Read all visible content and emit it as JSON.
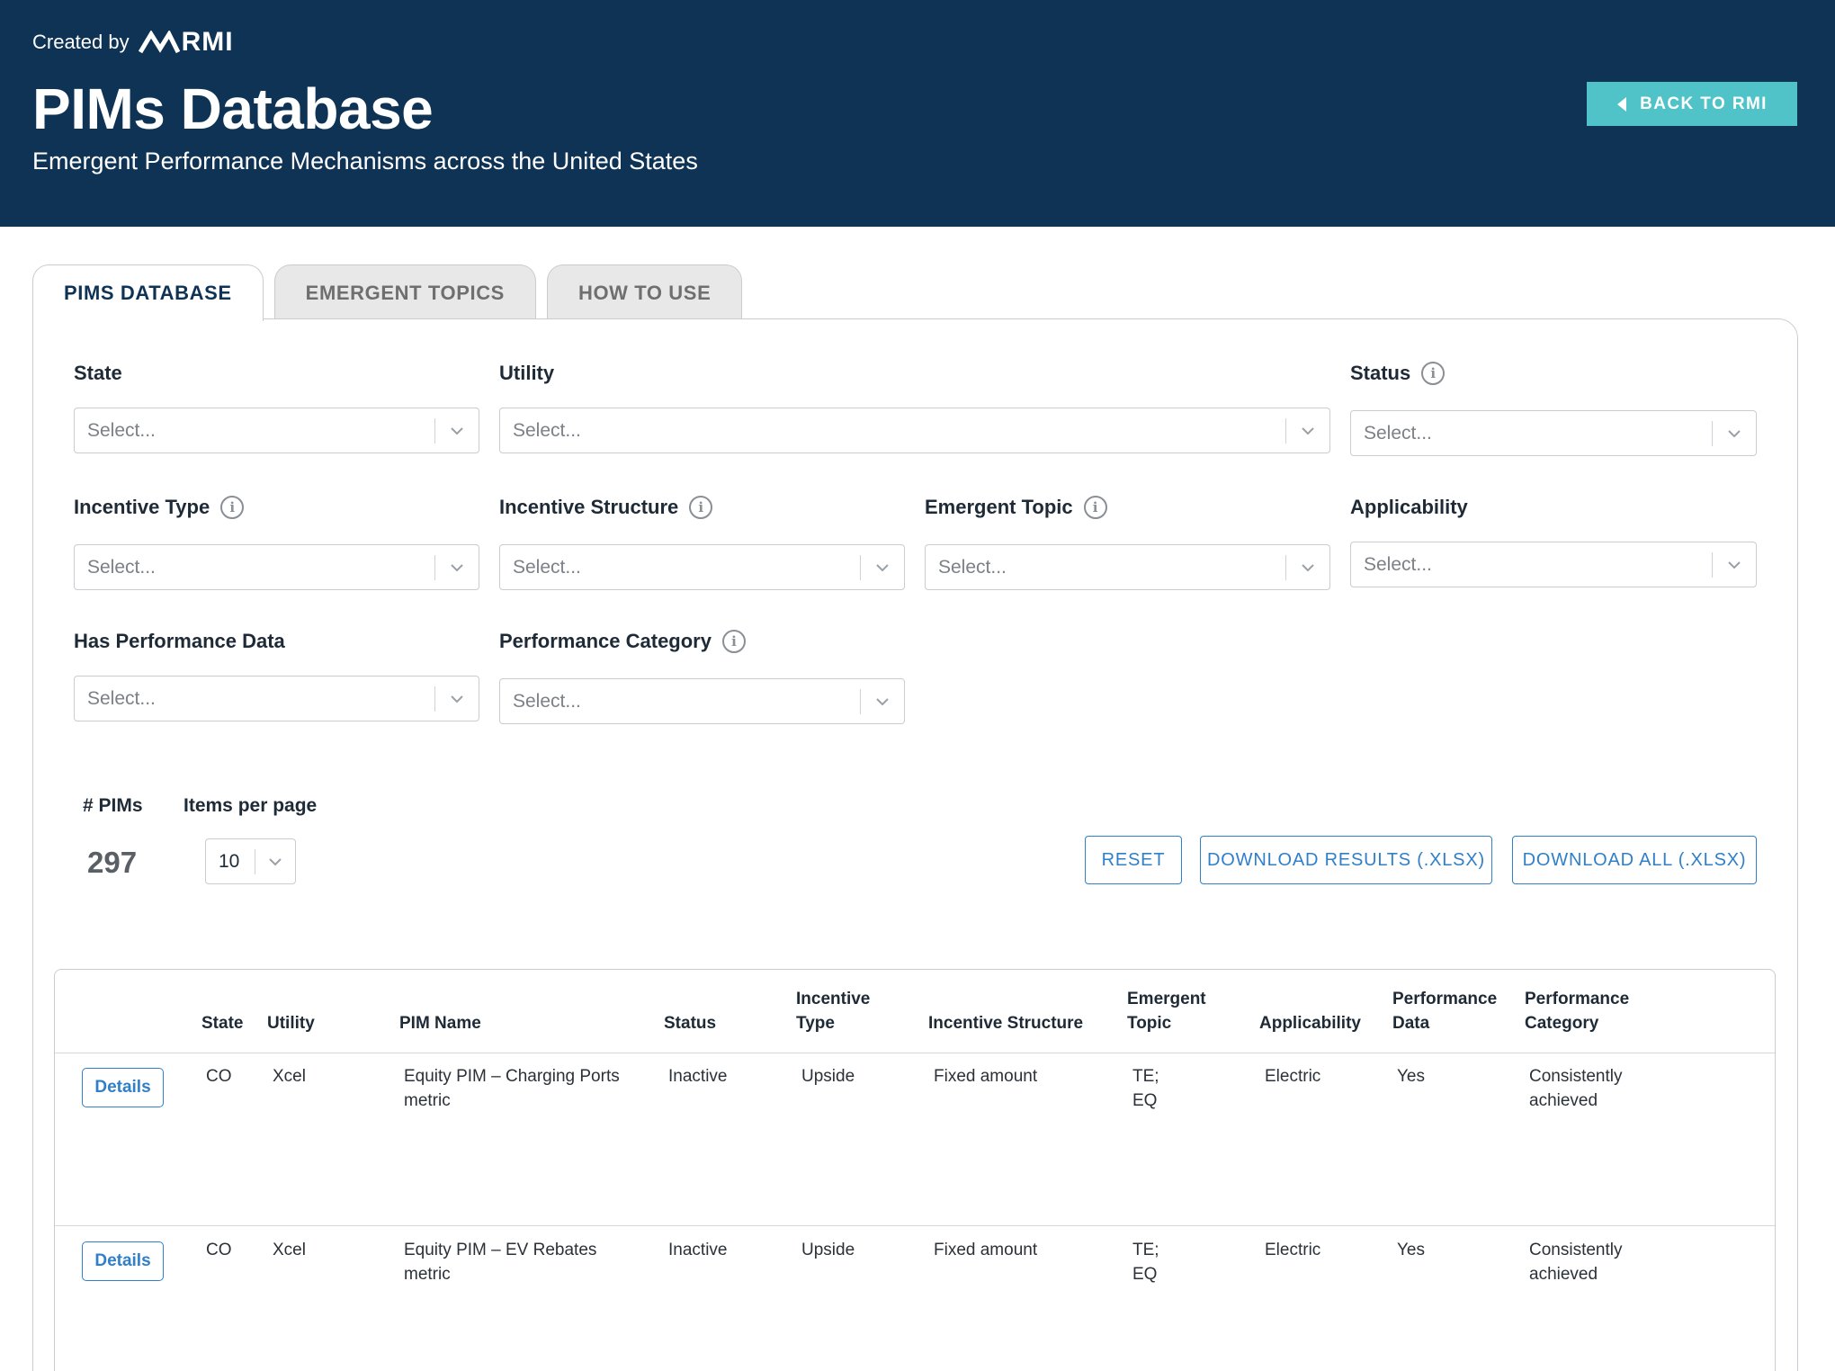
{
  "header": {
    "created_by": "Created by",
    "logo_text": "RMI",
    "title": "PIMs Database",
    "subtitle": "Emergent Performance Mechanisms across the United States",
    "back_button": "BACK TO RMI"
  },
  "tabs": [
    {
      "label": "PIMS DATABASE",
      "active": true
    },
    {
      "label": "EMERGENT TOPICS",
      "active": false
    },
    {
      "label": "HOW TO USE",
      "active": false
    }
  ],
  "filters": {
    "state": {
      "label": "State",
      "placeholder": "Select..."
    },
    "utility": {
      "label": "Utility",
      "placeholder": "Select..."
    },
    "status": {
      "label": "Status",
      "placeholder": "Select..."
    },
    "incentive_type": {
      "label": "Incentive Type",
      "placeholder": "Select..."
    },
    "incentive_structure": {
      "label": "Incentive Structure",
      "placeholder": "Select..."
    },
    "emergent_topic": {
      "label": "Emergent Topic",
      "placeholder": "Select..."
    },
    "applicability": {
      "label": "Applicability",
      "placeholder": "Select..."
    },
    "has_performance_data": {
      "label": "Has Performance Data",
      "placeholder": "Select..."
    },
    "performance_category": {
      "label": "Performance Category",
      "placeholder": "Select..."
    }
  },
  "summary": {
    "count_label": "# PIMs",
    "count_value": "297",
    "per_page_label": "Items per page",
    "per_page_value": "10"
  },
  "actions": {
    "reset": "RESET",
    "download_results": "DOWNLOAD RESULTS (.XLSX)",
    "download_all": "DOWNLOAD ALL (.XLSX)"
  },
  "table": {
    "headers": {
      "state": "State",
      "utility": "Utility",
      "pim_name": "PIM Name",
      "status": "Status",
      "incentive_type_1": "Incentive",
      "incentive_type_2": "Type",
      "incentive_structure": "Incentive Structure",
      "emergent_topic_1": "Emergent",
      "emergent_topic_2": "Topic",
      "applicability": "Applicability",
      "performance_data_1": "Performance",
      "performance_data_2": "Data",
      "performance_category_1": "Performance",
      "performance_category_2": "Category"
    },
    "details_label": "Details",
    "rows": [
      {
        "state": "CO",
        "utility": "Xcel",
        "pim_name_1": "Equity PIM – Charging Ports",
        "pim_name_2": "metric",
        "status": "Inactive",
        "incentive_type": "Upside",
        "incentive_structure": "Fixed amount",
        "topic_1": "TE;",
        "topic_2": "EQ",
        "applicability": "Electric",
        "performance_data": "Yes",
        "category_1": "Consistently",
        "category_2": "achieved"
      },
      {
        "state": "CO",
        "utility": "Xcel",
        "pim_name_1": "Equity PIM – EV Rebates",
        "pim_name_2": "metric",
        "status": "Inactive",
        "incentive_type": "Upside",
        "incentive_structure": "Fixed amount",
        "topic_1": "TE;",
        "topic_2": "EQ",
        "applicability": "Electric",
        "performance_data": "Yes",
        "category_1": "Consistently",
        "category_2": "achieved"
      }
    ]
  },
  "colors": {
    "header_bg": "#0f3355",
    "accent_teal": "#4fc3c7",
    "link_blue": "#2f7fc9"
  }
}
